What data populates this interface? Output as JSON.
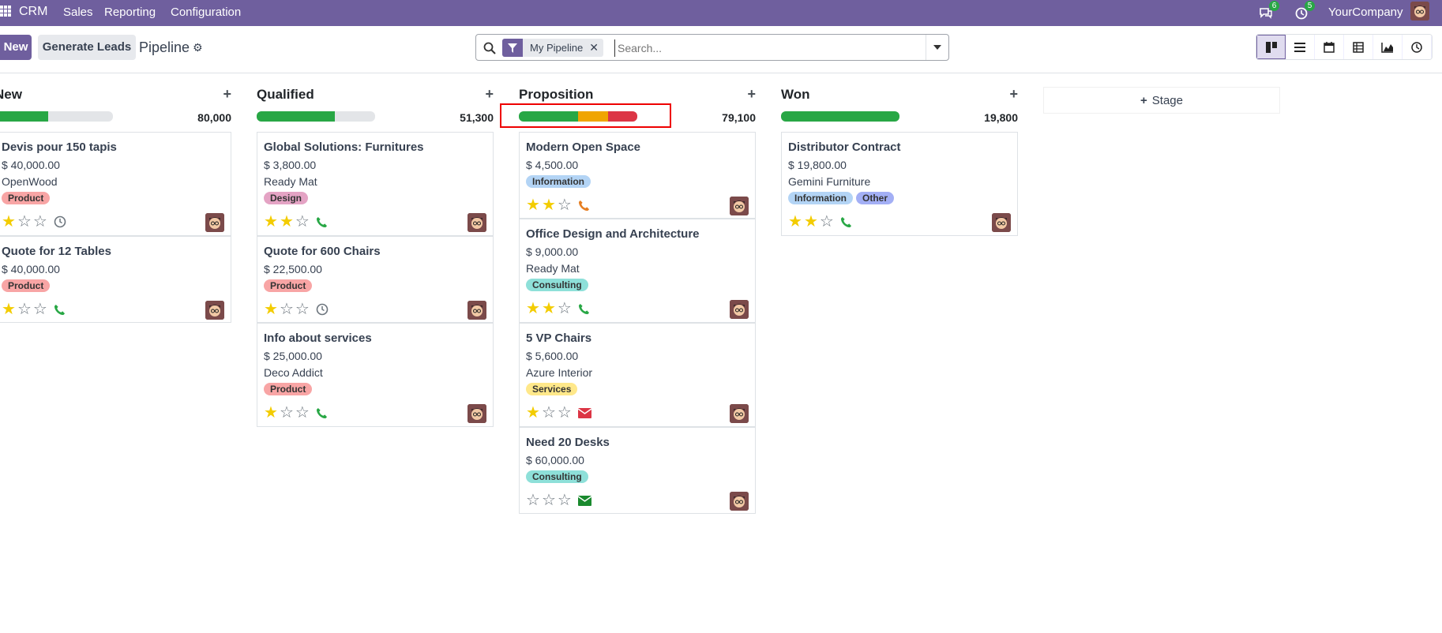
{
  "navbar": {
    "brand": "CRM",
    "menu": [
      "Sales",
      "Reporting",
      "Configuration"
    ],
    "messages_count": "6",
    "activities_count": "5",
    "company": "YourCompany"
  },
  "controls": {
    "new_label": "New",
    "generate_label": "Generate Leads",
    "title": "Pipeline",
    "facet_label": "My Pipeline",
    "search_placeholder": "Search..."
  },
  "columns": [
    {
      "title": "New",
      "total": "80,000",
      "progress": {
        "green": 0.45,
        "orange": 0,
        "red": 0
      }
    },
    {
      "title": "Qualified",
      "total": "51,300",
      "progress": {
        "green": 0.66,
        "orange": 0,
        "red": 0
      }
    },
    {
      "title": "Proposition",
      "total": "79,100",
      "progress": {
        "green": 0.5,
        "orange": 0.25,
        "red": 0.25
      }
    },
    {
      "title": "Won",
      "total": "19,800",
      "progress": {
        "green": 1,
        "orange": 0,
        "red": 0
      }
    }
  ],
  "stage_add_label": "Stage",
  "cards": {
    "new": [
      {
        "title": "Devis pour 150 tapis",
        "amount": "$ 40,000.00",
        "company": "OpenWood",
        "tags": [
          "Product"
        ],
        "stars": 1,
        "activity": "clock"
      },
      {
        "title": "Quote for 12 Tables",
        "amount": "$ 40,000.00",
        "company": "",
        "tags": [
          "Product"
        ],
        "stars": 1,
        "activity": "phone"
      }
    ],
    "qualified": [
      {
        "title": "Global Solutions: Furnitures",
        "amount": "$ 3,800.00",
        "company": "Ready Mat",
        "tags": [
          "Design"
        ],
        "stars": 2,
        "activity": "phone"
      },
      {
        "title": "Quote for 600 Chairs",
        "amount": "$ 22,500.00",
        "company": "",
        "tags": [
          "Product"
        ],
        "stars": 1,
        "activity": "clock"
      },
      {
        "title": "Info about services",
        "amount": "$ 25,000.00",
        "company": "Deco Addict",
        "tags": [
          "Product"
        ],
        "stars": 1,
        "activity": "phone"
      }
    ],
    "proposition": [
      {
        "title": "Modern Open Space",
        "amount": "$ 4,500.00",
        "company": "",
        "tags": [
          "Information"
        ],
        "stars": 2,
        "activity": "phone-orange"
      },
      {
        "title": "Office Design and Architecture",
        "amount": "$ 9,000.00",
        "company": "Ready Mat",
        "tags": [
          "Consulting"
        ],
        "stars": 2,
        "activity": "phone"
      },
      {
        "title": "5 VP Chairs",
        "amount": "$ 5,600.00",
        "company": "Azure Interior",
        "tags": [
          "Services"
        ],
        "stars": 1,
        "activity": "mail-red"
      },
      {
        "title": "Need 20 Desks",
        "amount": "$ 60,000.00",
        "company": "",
        "tags": [
          "Consulting"
        ],
        "stars": 0,
        "activity": "mail-green"
      }
    ],
    "won": [
      {
        "title": "Distributor Contract",
        "amount": "$ 19,800.00",
        "company": "Gemini Furniture",
        "tags": [
          "Information",
          "Other"
        ],
        "stars": 2,
        "activity": "phone"
      }
    ]
  },
  "tag_colors": {
    "Product": "#f8a5a5",
    "Design": "#e4a3c4",
    "Information": "#b3d4f5",
    "Consulting": "#8ee0d9",
    "Services": "#ffe88a",
    "Other": "#a3aff5"
  },
  "colors": {
    "brand": "#6f5f9e",
    "green": "#28a745",
    "orange": "#f0a500",
    "red": "#dc3545"
  }
}
